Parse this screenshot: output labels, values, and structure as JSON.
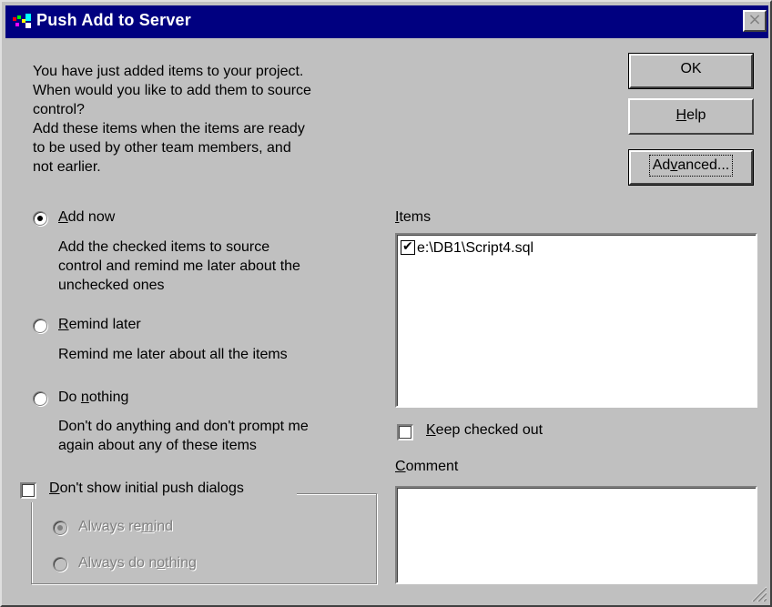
{
  "window": {
    "title": "Push Add to Server",
    "close_label": "×"
  },
  "intro": {
    "lines": [
      "You have just added items to your project.",
      "When would you like to add them to source",
      "control?",
      "Add these items when the items are ready",
      "to be used by other team members, and",
      "not earlier."
    ]
  },
  "buttons": {
    "ok": "OK",
    "help_u": "H",
    "help_rest": "elp",
    "advanced_pre": "Ad",
    "advanced_u": "v",
    "advanced_post": "anced..."
  },
  "options": {
    "add_now": {
      "u": "A",
      "rest": "dd now",
      "selected": true,
      "desc_lines": [
        "Add the checked items to source",
        "control and remind me later about the",
        "unchecked ones"
      ]
    },
    "remind_later": {
      "u": "R",
      "rest": "emind later",
      "selected": false,
      "desc_lines": [
        "Remind me later about all the items"
      ]
    },
    "do_nothing": {
      "pre": "Do ",
      "u": "n",
      "rest": "othing",
      "selected": false,
      "desc_lines": [
        "Don't do anything and don't prompt me",
        "again about any of these items"
      ]
    }
  },
  "items": {
    "label_u": "I",
    "label_rest": "tems",
    "list": [
      {
        "label": "e:\\DB1\\Script4.sql",
        "checked": true
      }
    ]
  },
  "keep_checked_out": {
    "u": "K",
    "rest": "eep checked out",
    "checked": false
  },
  "comment": {
    "label_u": "C",
    "label_rest": "omment",
    "value": ""
  },
  "initial_push": {
    "label_u": "D",
    "label_rest": "on't show initial push dialogs",
    "checked": false,
    "always_remind": {
      "pre": "Always re",
      "u": "m",
      "rest": "ind",
      "selected": true
    },
    "always_do_nothing": {
      "pre": "Always do n",
      "u": "o",
      "rest": "thing",
      "selected": false
    }
  },
  "colors": {
    "titlebar": "#000080",
    "face": "#c0c0c0",
    "disabled_text": "#808080"
  }
}
